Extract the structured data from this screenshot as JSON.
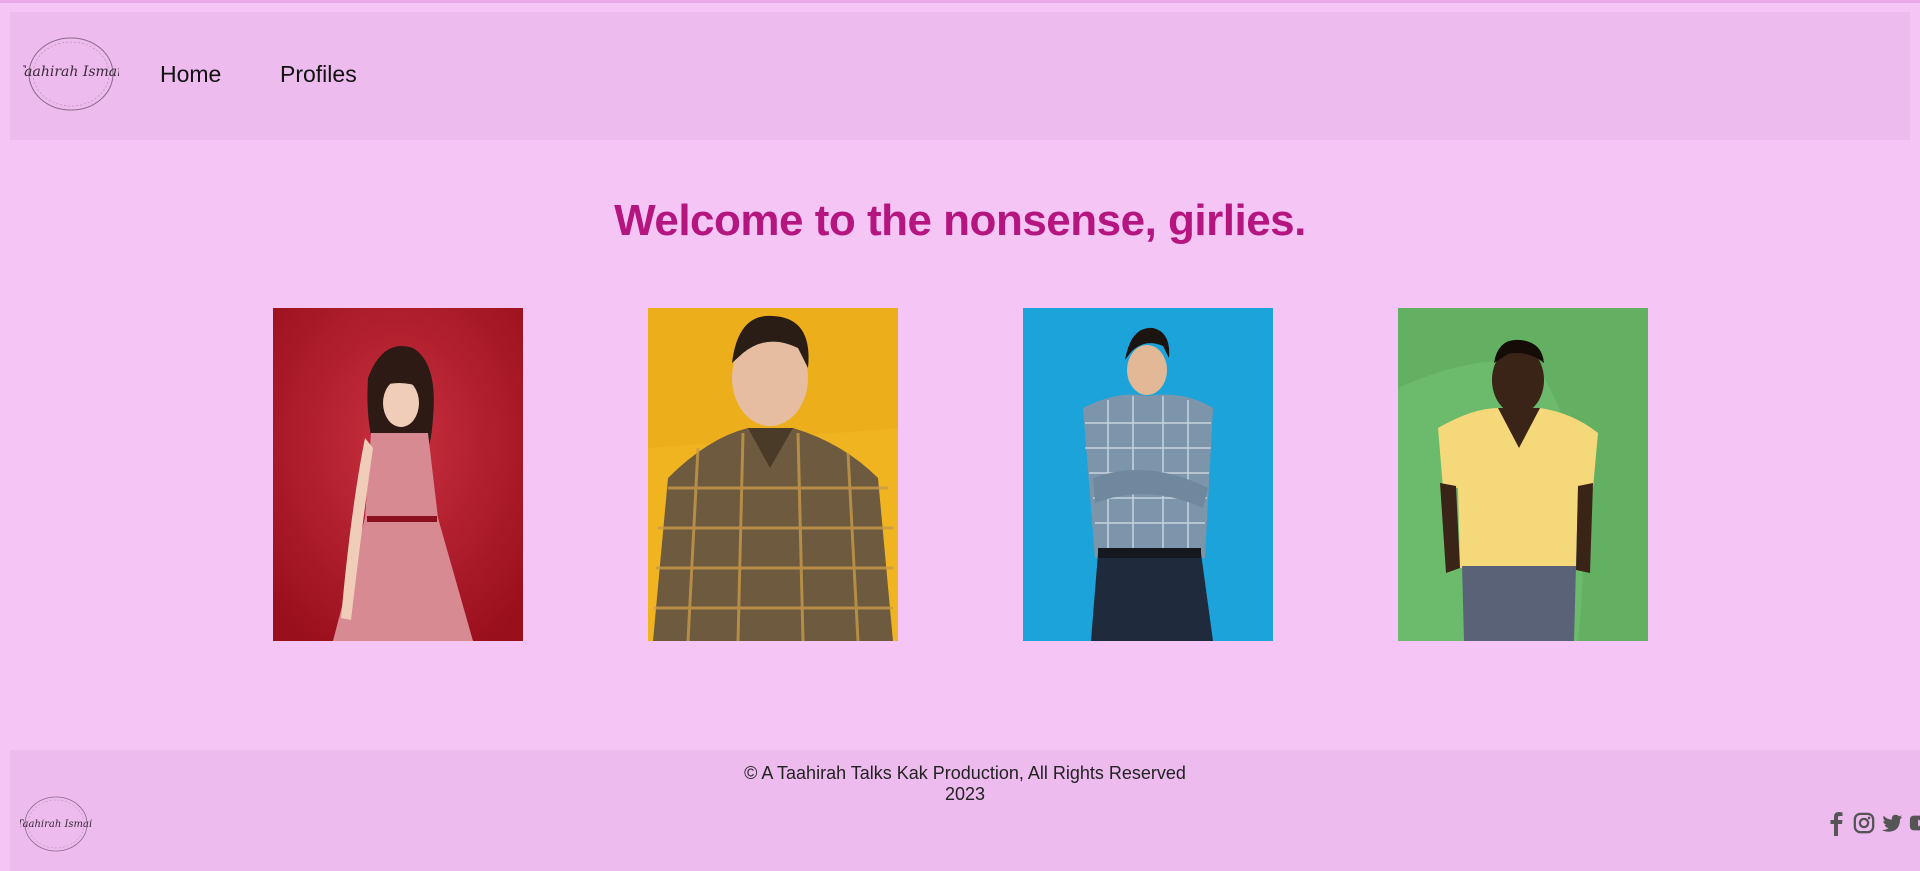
{
  "header": {
    "logo_text": "Taahirah Ismail",
    "nav": [
      {
        "label": "Home"
      },
      {
        "label": "Profiles"
      }
    ]
  },
  "main": {
    "title": "Welcome to the nonsense, girlies.",
    "profiles": [
      {
        "name": "profile-photo-red",
        "bg": "#b91f2d"
      },
      {
        "name": "profile-photo-yellow",
        "bg": "#f0b420"
      },
      {
        "name": "profile-photo-blue",
        "bg": "#1aa2d8"
      },
      {
        "name": "profile-photo-green",
        "bg": "#6cbb6c"
      }
    ]
  },
  "footer": {
    "copyright": "© A Taahirah Talks Kak Production, All Rights Reserved",
    "year": "2023",
    "social": [
      "facebook-icon",
      "instagram-icon",
      "twitter-icon",
      "youtube-icon"
    ]
  },
  "colors": {
    "background": "#f5c6f5",
    "header": "#edbbee",
    "title": "#b5157f"
  }
}
